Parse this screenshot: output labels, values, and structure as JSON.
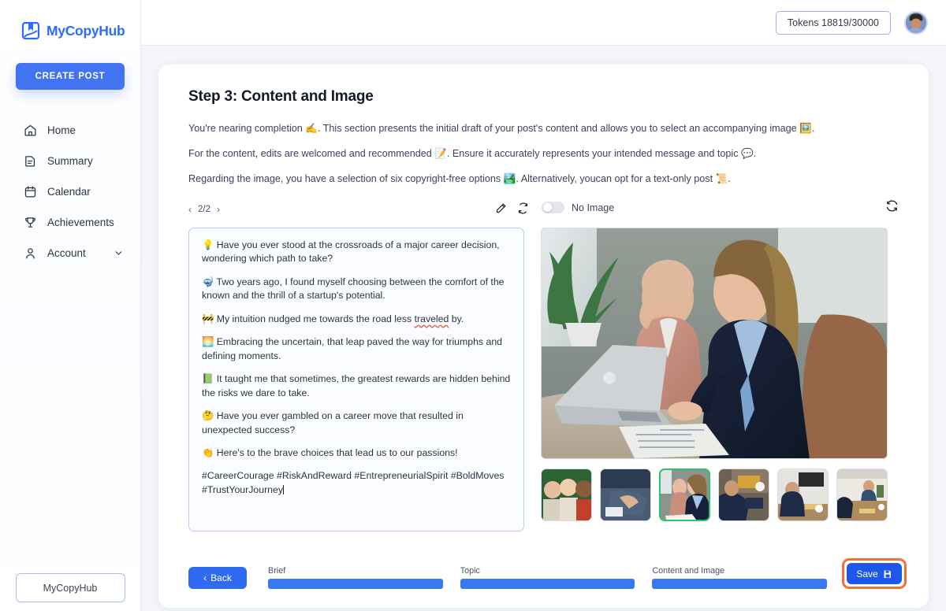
{
  "brand": {
    "name": "MyCopyHub",
    "logo_icon": "book-bookmark-icon",
    "color": "#2f6bff"
  },
  "sidebar": {
    "create_post_label": "CREATE POST",
    "items": [
      {
        "label": "Home",
        "icon": "home-icon"
      },
      {
        "label": "Summary",
        "icon": "document-icon"
      },
      {
        "label": "Calendar",
        "icon": "calendar-icon"
      },
      {
        "label": "Achievements",
        "icon": "trophy-icon"
      },
      {
        "label": "Account",
        "icon": "user-icon",
        "chevron": "chevron-down-icon"
      }
    ],
    "footer_button_label": "MyCopyHub"
  },
  "topbar": {
    "tokens_label": "Tokens 18819/30000",
    "avatar_icon": "user-avatar"
  },
  "main": {
    "title": "Step 3: Content and Image",
    "intro": [
      "You're nearing completion ✍️. This section presents the initial draft of your post's content and allows you to select an accompanying image 🖼️.",
      "For the content, edits are welcomed and recommended 📝. Ensure it accurately represents your intended message and topic 💬.",
      "Regarding the image, you have a selection of six copyright-free options 🏞️. Alternatively, youcan opt for a text-only post 📜."
    ],
    "toolbar": {
      "prev_icon": "chevron-left-icon",
      "next_icon": "chevron-right-icon",
      "page_indicator": "2/2",
      "edit_icon": "pencil-icon",
      "regenerate_icon": "refresh-icon",
      "no_image_toggle_label": "No Image",
      "no_image_toggle_state": "off",
      "refresh_images_icon": "refresh-circle-icon"
    },
    "editor": {
      "paragraphs": [
        {
          "emoji": "💡",
          "text": "Have you ever stood at the crossroads of a major career decision, wondering which path to take?"
        },
        {
          "emoji": "🤿",
          "text": "Two years ago, I found myself choosing between the comfort of the known and the thrill of a startup's potential."
        },
        {
          "emoji": "🚧",
          "text": "My intuition nudged me towards the road less traveled by.",
          "misspelled_word": "traveled"
        },
        {
          "emoji": "🌅",
          "text": "Embracing the uncertain, that leap paved the way for triumphs and defining moments."
        },
        {
          "emoji": "📗",
          "text": "It taught me that sometimes, the greatest rewards are hidden behind the risks we dare to take."
        },
        {
          "emoji": "🤔",
          "text": "Have you ever gambled on a career move that resulted in unexpected success?"
        },
        {
          "emoji": "👏",
          "text": "Here's to the brave choices that lead us to our passions!"
        }
      ],
      "hashtags": "#CareerCourage #RiskAndReward #EntrepreneurialSpirit #BoldMoves #TrustYourJourney"
    },
    "image": {
      "main_alt": "two colleagues looking at a laptop in an office",
      "thumbnails": [
        {
          "alt": "three women standing by greenery",
          "selected": false
        },
        {
          "alt": "close-up of hands and documents",
          "selected": false
        },
        {
          "alt": "two colleagues at a laptop",
          "selected": true
        },
        {
          "alt": "meeting table with coffee cups",
          "selected": false
        },
        {
          "alt": "person at a conference table",
          "selected": false
        },
        {
          "alt": "group business meeting",
          "selected": false
        }
      ],
      "selected_index": 2,
      "selection_color": "#2fbf71"
    },
    "footer": {
      "back_label": "Back",
      "back_icon": "chevron-left-icon",
      "steps": [
        {
          "label": "Brief",
          "progress": 100
        },
        {
          "label": "Topic",
          "progress": 100
        },
        {
          "label": "Content and Image",
          "progress": 100
        }
      ],
      "save_label": "Save",
      "save_icon": "floppy-disk-icon",
      "save_highlight_color": "#f3703a"
    }
  }
}
